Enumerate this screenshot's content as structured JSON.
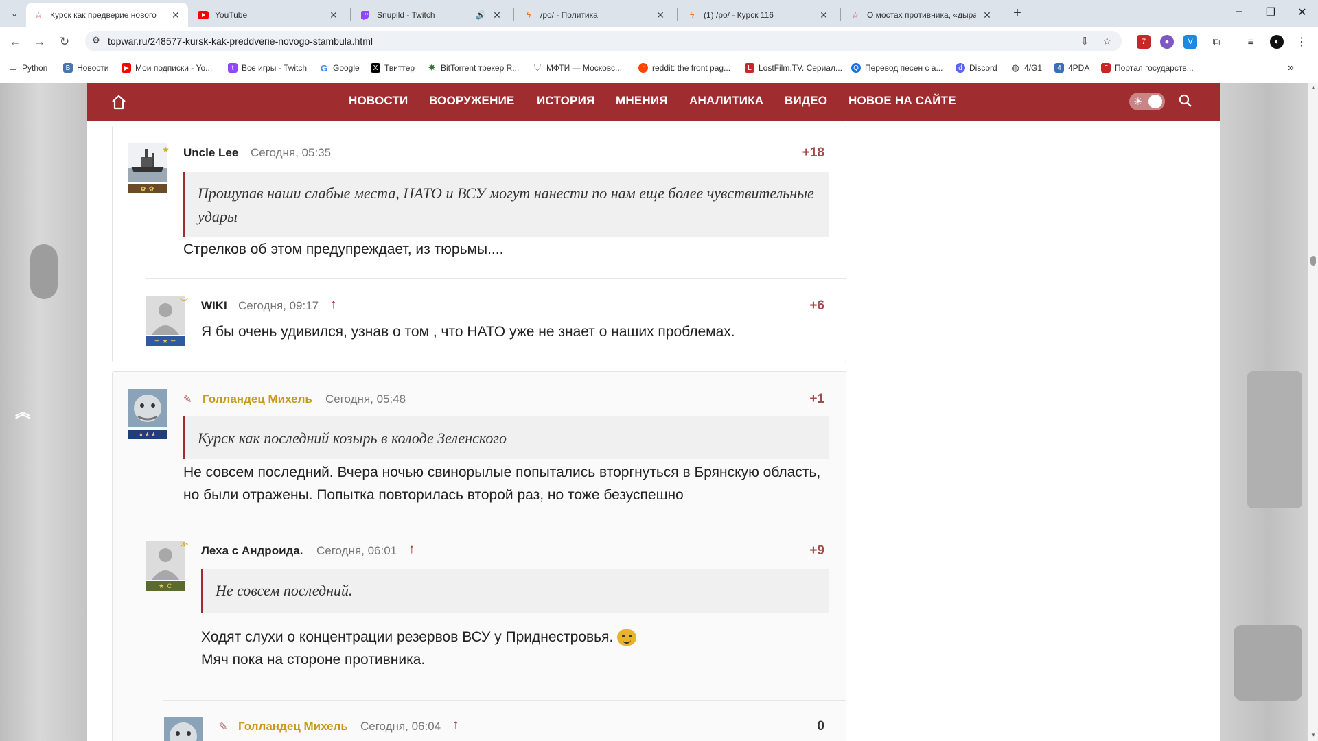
{
  "tabs": [
    {
      "title": "Курск как предверие нового",
      "favicon": "star-icon",
      "active": true
    },
    {
      "title": "YouTube",
      "favicon": "youtube-icon",
      "active": false
    },
    {
      "title": "Snupild - Twitch",
      "favicon": "twitch-icon",
      "active": false,
      "audio": true
    },
    {
      "title": "/po/ - Политика",
      "favicon": "bolt-icon",
      "active": false
    },
    {
      "title": "(1) /po/ - Курск 116",
      "favicon": "bolt-icon",
      "active": false
    },
    {
      "title": "О мостах противника, «дыра",
      "favicon": "star-icon",
      "active": false
    }
  ],
  "address_bar": {
    "url": "topwar.ru/248577-kursk-kak-preddverie-novogo-stambula.html"
  },
  "bookmarks": [
    {
      "label": "Python",
      "icon": "folder-icon"
    },
    {
      "label": "Новости",
      "icon": "vk-icon"
    },
    {
      "label": "Мои подписки - Yo...",
      "icon": "youtube-icon"
    },
    {
      "label": "Все игры - Twitch",
      "icon": "twitch-icon"
    },
    {
      "label": "Google",
      "icon": "google-icon"
    },
    {
      "label": "Твиттер",
      "icon": "x-icon"
    },
    {
      "label": "BitTorrent трекер R...",
      "icon": "rutracker-icon"
    },
    {
      "label": "МФТИ — Московс...",
      "icon": "mipt-icon"
    },
    {
      "label": "reddit: the front pag...",
      "icon": "reddit-icon"
    },
    {
      "label": "LostFilm.TV. Сериал...",
      "icon": "lostfilm-icon"
    },
    {
      "label": "Перевод песен с а...",
      "icon": "translate-icon"
    },
    {
      "label": "Discord",
      "icon": "discord-icon"
    },
    {
      "label": "4/G1",
      "icon": "globe-icon"
    },
    {
      "label": "4PDA",
      "icon": "4pda-icon"
    },
    {
      "label": "Портал государств...",
      "icon": "gosuslugi-icon"
    }
  ],
  "site_nav": {
    "items": [
      "НОВОСТИ",
      "ВООРУЖЕНИЕ",
      "ИСТОРИЯ",
      "МНЕНИЯ",
      "АНАЛИТИКА",
      "ВИДЕО",
      "НОВОЕ НА САЙТЕ"
    ],
    "current": "АНАЛИТИКА"
  },
  "comments": [
    {
      "author": "Uncle Lee",
      "time": "Сегодня, 05:35",
      "score": "+18",
      "quote": "Прощупав наши слабые места, НАТО и ВСУ могут нанести по нам еще более чувствительные удары",
      "text": "Стрелков об этом предупреждает, из тюрьмы...."
    },
    {
      "author": "WIKI",
      "time": "Сегодня, 09:17",
      "score": "+6",
      "text": "Я бы очень удивился, узнав о том , что НАТО уже не знает о наших проблемах."
    },
    {
      "author": "Голландец Михель",
      "time": "Сегодня, 05:48",
      "score": "+1",
      "rank_text": "★★★",
      "quote": "Курск как последний козырь в колоде Зеленского",
      "text": "Не совсем последний. Вчера ночью свинорылые попытались вторгнуться в Брянскую область, но были отражены. Попытка повторилась второй раз, но тоже безуспешно"
    },
    {
      "author": "Леха с Андроида.",
      "time": "Сегодня, 06:01",
      "score": "+9",
      "rank_text": "★ С",
      "quote": "Не совсем последний.",
      "text_line1": "Ходят слухи о концентрации резервов ВСУ у Приднестровья.",
      "text_line2": "Мяч пока на стороне противника."
    },
    {
      "author": "Голландец Михель",
      "time": "Сегодня, 06:04",
      "score": "0"
    }
  ],
  "colors": {
    "brand": "#9f2c2f",
    "score": "#a34a4a",
    "gold_author": "#c99a18"
  }
}
